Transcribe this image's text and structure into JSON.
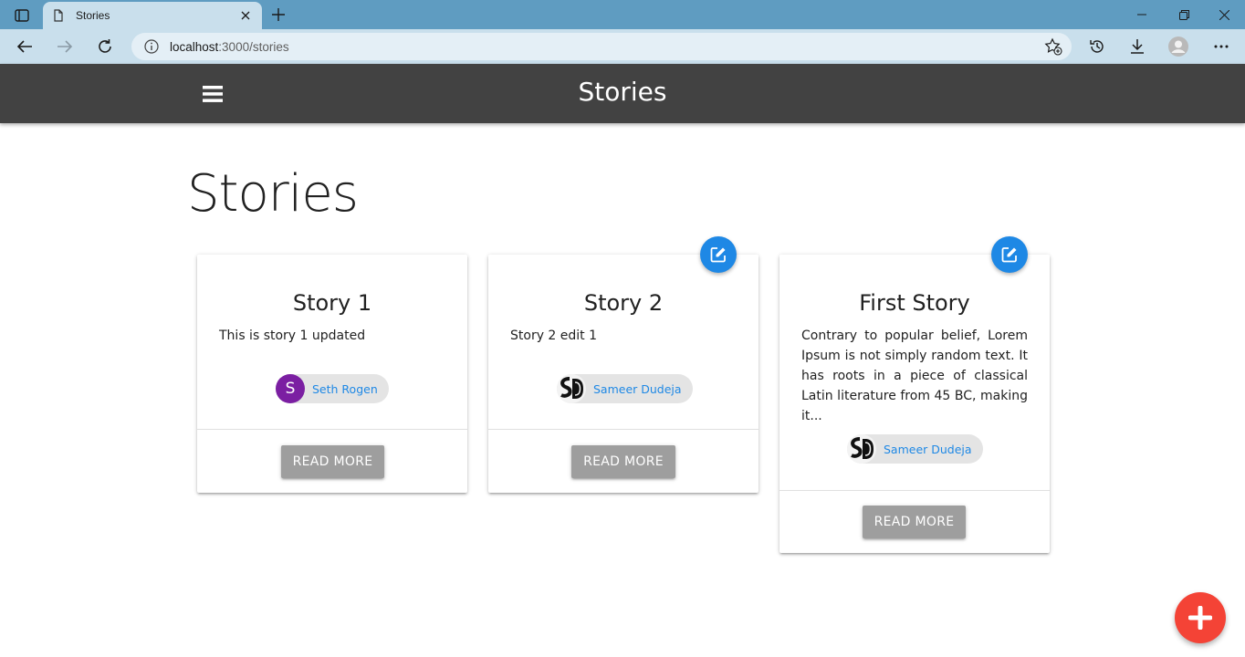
{
  "browser": {
    "tab_title": "Stories",
    "url_host": "localhost",
    "url_path": ":3000/stories"
  },
  "appbar": {
    "title": "Stories"
  },
  "page": {
    "heading": "Stories"
  },
  "stories": [
    {
      "title": "Story 1",
      "text": "This is story 1 updated",
      "author": "Seth Rogen",
      "avatar_letter": "S",
      "read_more": "READ MORE",
      "editable": false
    },
    {
      "title": "Story 2",
      "text": "Story 2 edit 1",
      "author": "Sameer Dudeja",
      "avatar_logo": "SD",
      "read_more": "READ MORE",
      "editable": true
    },
    {
      "title": "First Story",
      "text": "Contrary to popular belief, Lorem Ipsum is not simply random text. It has roots in a piece of classical Latin literature from 45 BC, making it...",
      "author": "Sameer Dudeja",
      "avatar_logo": "SD",
      "read_more": "READ MORE",
      "editable": true
    }
  ],
  "colors": {
    "appbar": "#424242",
    "edit_fab": "#1e88e5",
    "add_fab": "#f44336",
    "chip_label": "#1e88e5",
    "avatar_purple": "#7b1fa2",
    "button_grey": "#9e9e9e"
  },
  "icons": {
    "menu": "hamburger-icon",
    "edit": "edit-icon",
    "add": "plus-icon"
  }
}
